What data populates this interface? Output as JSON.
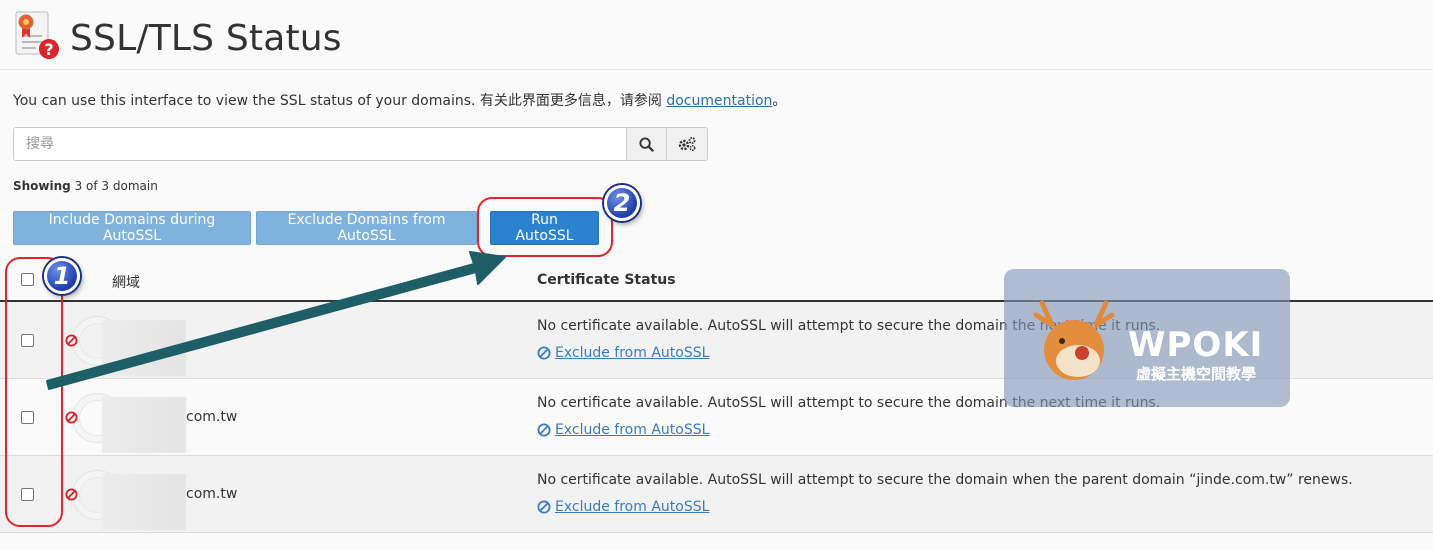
{
  "header": {
    "title": "SSL/TLS Status"
  },
  "intro": {
    "text": "You can use this interface to view the SSL status of your domains. 有关此界面更多信息，请参阅 ",
    "link": "documentation",
    "suffix": "。"
  },
  "search": {
    "placeholder": "搜尋",
    "value": ""
  },
  "showing": {
    "label": "Showing",
    "count": "3 of 3 domain"
  },
  "toolbar": {
    "include_label": "Include Domains during AutoSSL",
    "exclude_label": "Exclude Domains from AutoSSL",
    "run_label": "Run AutoSSL"
  },
  "table": {
    "col_domain": "網域",
    "col_status": "Certificate Status",
    "rows": [
      {
        "domain": "",
        "status": "No certificate available. AutoSSL will attempt to secure the domain the next time it runs.",
        "action": "Exclude from AutoSSL"
      },
      {
        "domain": "com.tw",
        "status": "No certificate available. AutoSSL will attempt to secure the domain the next time it runs.",
        "action": "Exclude from AutoSSL"
      },
      {
        "domain": "com.tw",
        "status": "No certificate available. AutoSSL will attempt to secure the domain when the parent domain “jinde.com.tw” renews.",
        "action": "Exclude from AutoSSL"
      }
    ]
  },
  "annotations": {
    "badge1": "1",
    "badge2": "2"
  },
  "watermark": {
    "brand": "WPOKI",
    "sub": "虛擬主機空間教學"
  },
  "colors": {
    "primary": "#2b83cf",
    "light_button": "#7fb2dc",
    "link": "#3a7cc0",
    "annotation_red": "#e0262b",
    "arrow": "#1e5e66"
  }
}
